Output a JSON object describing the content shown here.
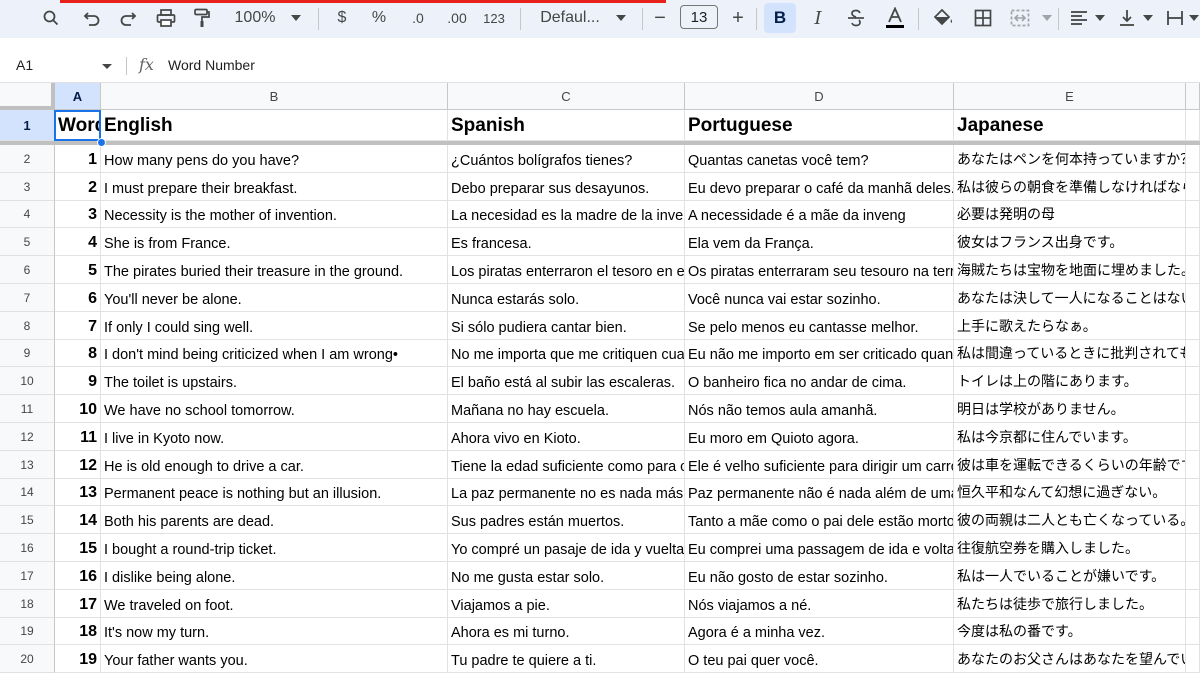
{
  "toolbar": {
    "zoom": "100%",
    "currency": "$",
    "percent": "%",
    "decrease_decimal": ".0",
    "increase_decimal": ".00",
    "number_format": "123",
    "font_name": "Defaul...",
    "minus": "−",
    "font_size": "13",
    "plus": "+",
    "bold": "B",
    "italic": "I"
  },
  "formula_bar": {
    "cell_ref": "A1",
    "fx": "fx",
    "value": "Word Number"
  },
  "columns": [
    {
      "id": "A",
      "label": "A"
    },
    {
      "id": "B",
      "label": "B"
    },
    {
      "id": "C",
      "label": "C"
    },
    {
      "id": "D",
      "label": "D"
    },
    {
      "id": "E",
      "label": "E"
    }
  ],
  "header_row": {
    "row": "1",
    "cells": [
      "Word Number",
      "English",
      "Spanish",
      "Portuguese",
      "Japanese"
    ]
  },
  "rows": [
    {
      "row": "2",
      "num": "1",
      "en": "How many pens do you have?",
      "es": "¿Cuántos bolígrafos tienes?",
      "pt": "Quantas canetas você tem?",
      "ja": "あなたはペンを何本持っていますか？"
    },
    {
      "row": "3",
      "num": "2",
      "en": "I must prepare their breakfast.",
      "es": "Debo preparar sus desayunos.",
      "pt": "Eu devo preparar o café da manhã deles.",
      "ja": "私は彼らの朝食を準備しなければならない。"
    },
    {
      "row": "4",
      "num": "3",
      "en": "Necessity is the mother of invention.",
      "es": "La necesidad es la madre de la invención.",
      "pt": "A necessidade é a mãe da inveng",
      "ja": "必要は発明の母"
    },
    {
      "row": "5",
      "num": "4",
      "en": "She is from France.",
      "es": "Es francesa.",
      "pt": "Ela vem da França.",
      "ja": "彼女はフランス出身です。"
    },
    {
      "row": "6",
      "num": "5",
      "en": "The pirates buried their treasure in the ground.",
      "es": "Los piratas enterraron el tesoro en el suelo.",
      "pt": "Os piratas enterraram seu tesouro na terra.",
      "ja": "海賊たちは宝物を地面に埋めました。"
    },
    {
      "row": "7",
      "num": "6",
      "en": "You'll never be alone.",
      "es": "Nunca estarás solo.",
      "pt": "Você nunca vai estar sozinho.",
      "ja": "あなたは決して一人になることはない。"
    },
    {
      "row": "8",
      "num": "7",
      "en": "If only I could sing well.",
      "es": "Si sólo pudiera cantar bien.",
      "pt": "Se pelo menos eu cantasse melhor.",
      "ja": "上手に歌えたらなぁ。"
    },
    {
      "row": "9",
      "num": "8",
      "en": "I don't mind being criticized when I am wrong•",
      "es": "No me importa que me critiquen cuando me equivoco.",
      "pt": "Eu não me importo em ser criticado quando estou errado.",
      "ja": "私は間違っているときに批判されても構わない。"
    },
    {
      "row": "10",
      "num": "9",
      "en": "The toilet is upstairs.",
      "es": "El baño está al subir las escaleras.",
      "pt": "O banheiro fica no andar de cima.",
      "ja": "トイレは上の階にあります。"
    },
    {
      "row": "11",
      "num": "10",
      "en": "We have no school tomorrow.",
      "es": "Mañana no hay escuela.",
      "pt": "Nós não temos aula amanhã.",
      "ja": "明日は学校がありません。"
    },
    {
      "row": "12",
      "num": "11",
      "en": "I live in Kyoto now.",
      "es": "Ahora vivo en Kioto.",
      "pt": "Eu moro em Quioto agora.",
      "ja": "私は今京都に住んでいます。"
    },
    {
      "row": "13",
      "num": "12",
      "en": "He is old enough to drive a car.",
      "es": "Tiene la edad suficiente como para conducir.",
      "pt": "Ele é velho suficiente para dirigir um carro.",
      "ja": "彼は車を運転できるくらいの年齢です。"
    },
    {
      "row": "14",
      "num": "13",
      "en": "Permanent peace is nothing but an illusion.",
      "es": "La paz permanente no es nada más que una ilusión.",
      "pt": "Paz permanente não é nada além de uma ilusão.",
      "ja": "恒久平和なんて幻想に過ぎない。"
    },
    {
      "row": "15",
      "num": "14",
      "en": "Both his parents are dead.",
      "es": "Sus padres están muertos.",
      "pt": "Tanto a mãe como o pai dele estão mortos.",
      "ja": "彼の両親は二人とも亡くなっている。"
    },
    {
      "row": "16",
      "num": "15",
      "en": "I bought a round-trip ticket.",
      "es": "Yo compré un pasaje de ida y vuelta.",
      "pt": "Eu comprei uma passagem de ida e volta.",
      "ja": "往復航空券を購入しました。"
    },
    {
      "row": "17",
      "num": "16",
      "en": "I dislike being alone.",
      "es": "No me gusta estar solo.",
      "pt": "Eu não gosto de estar sozinho.",
      "ja": "私は一人でいることが嫌いです。"
    },
    {
      "row": "18",
      "num": "17",
      "en": "We traveled on foot.",
      "es": "Viajamos a pie.",
      "pt": "Nós viajamos a né.",
      "ja": "私たちは徒歩で旅行しました。"
    },
    {
      "row": "19",
      "num": "18",
      "en": "It's now my turn.",
      "es": "Ahora es mi turno.",
      "pt": "Agora é a minha vez.",
      "ja": "今度は私の番です。"
    },
    {
      "row": "20",
      "num": "19",
      "en": "Your father wants you.",
      "es": "Tu padre te quiere a ti.",
      "pt": "O teu pai quer você.",
      "ja": "あなたのお父さんはあなたを望んでいる。"
    }
  ],
  "colors": {
    "toolbar_bg": "#edf2fa",
    "selection": "#1a73e8",
    "selected_header": "#d3e3fd",
    "accent_red": "#e8221b"
  }
}
